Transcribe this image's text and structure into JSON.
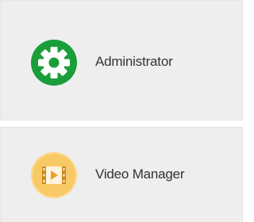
{
  "menu": {
    "items": [
      {
        "label": "Administrator",
        "icon": "gear-icon",
        "icon_color": "#1a9e3a"
      },
      {
        "label": "Video Manager",
        "icon": "film-play-icon",
        "icon_color": "#f8c964"
      }
    ]
  }
}
